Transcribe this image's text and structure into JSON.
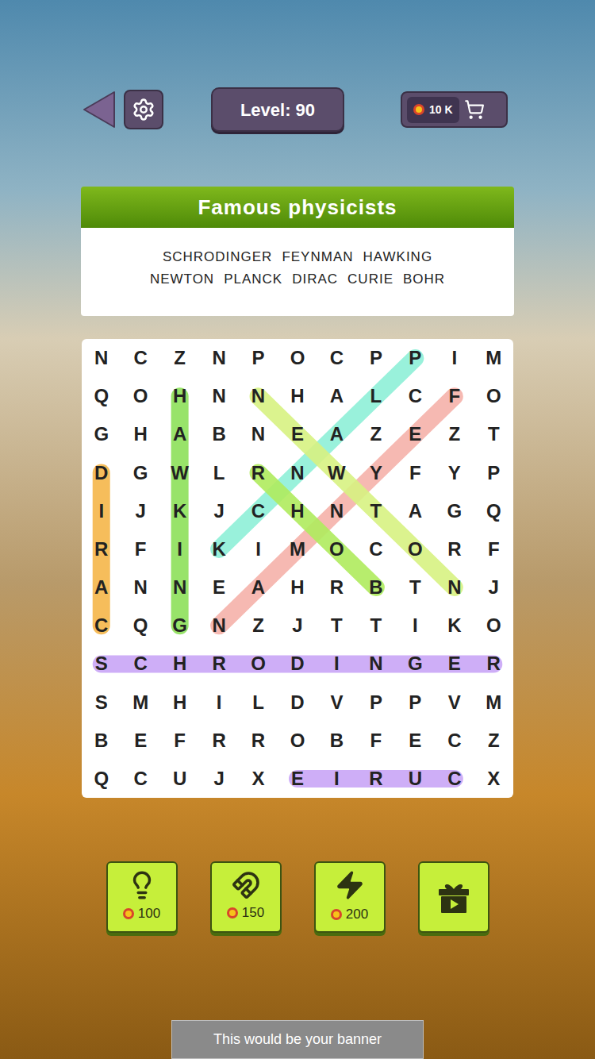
{
  "top_bar": {
    "level": "Level: 90",
    "coins": "10 K"
  },
  "category": {
    "title": "Famous physicists",
    "word_rows": [
      [
        "SCHRODINGER",
        "FEYNMAN",
        "HAWKING"
      ],
      [
        "NEWTON",
        "PLANCK",
        "DIRAC",
        "CURIE",
        "BOHR"
      ]
    ]
  },
  "grid": {
    "rows": [
      [
        "N",
        "C",
        "Z",
        "N",
        "P",
        "O",
        "C",
        "P",
        "P",
        "I",
        "M"
      ],
      [
        "Q",
        "O",
        "H",
        "N",
        "N",
        "H",
        "A",
        "L",
        "C",
        "F",
        "O"
      ],
      [
        "G",
        "H",
        "A",
        "B",
        "N",
        "E",
        "A",
        "Z",
        "E",
        "Z",
        "T"
      ],
      [
        "D",
        "G",
        "W",
        "L",
        "R",
        "N",
        "W",
        "Y",
        "F",
        "Y",
        "P"
      ],
      [
        "I",
        "J",
        "K",
        "J",
        "C",
        "H",
        "N",
        "T",
        "A",
        "G",
        "Q"
      ],
      [
        "R",
        "F",
        "I",
        "K",
        "I",
        "M",
        "O",
        "C",
        "O",
        "R",
        "F"
      ],
      [
        "A",
        "N",
        "N",
        "E",
        "A",
        "H",
        "R",
        "B",
        "T",
        "N",
        "J"
      ],
      [
        "C",
        "Q",
        "G",
        "N",
        "Z",
        "J",
        "T",
        "T",
        "I",
        "K",
        "O"
      ],
      [
        "S",
        "C",
        "H",
        "R",
        "O",
        "D",
        "I",
        "N",
        "G",
        "E",
        "R"
      ],
      [
        "S",
        "M",
        "H",
        "I",
        "L",
        "D",
        "V",
        "P",
        "P",
        "V",
        "M"
      ],
      [
        "B",
        "E",
        "F",
        "R",
        "R",
        "O",
        "B",
        "F",
        "E",
        "C",
        "Z"
      ],
      [
        "Q",
        "C",
        "U",
        "J",
        "X",
        "E",
        "I",
        "R",
        "U",
        "C",
        "X"
      ]
    ]
  },
  "found": [
    {
      "start": [
        3,
        0
      ],
      "end": [
        7,
        0
      ],
      "color": "#f6b64a"
    },
    {
      "start": [
        1,
        2
      ],
      "end": [
        7,
        2
      ],
      "color": "#8de05a"
    },
    {
      "start": [
        0,
        8
      ],
      "end": [
        5,
        3
      ],
      "color": "#8ef0d8"
    },
    {
      "start": [
        1,
        9
      ],
      "end": [
        7,
        3
      ],
      "color": "#f6b2aa"
    },
    {
      "start": [
        1,
        4
      ],
      "end": [
        6,
        9
      ],
      "color": "#d8f282"
    },
    {
      "start": [
        3,
        4
      ],
      "end": [
        6,
        7
      ],
      "color": "#b0ec5e"
    },
    {
      "start": [
        8,
        0
      ],
      "end": [
        8,
        10
      ],
      "color": "#c9a6f7"
    },
    {
      "start": [
        11,
        5
      ],
      "end": [
        11,
        9
      ],
      "color": "#c9a6f7"
    }
  ],
  "boosters": [
    {
      "kind": "hint",
      "price": "100"
    },
    {
      "kind": "magnet",
      "price": "150"
    },
    {
      "kind": "power",
      "price": "200"
    },
    {
      "kind": "video"
    }
  ],
  "banner": "This would be your banner"
}
